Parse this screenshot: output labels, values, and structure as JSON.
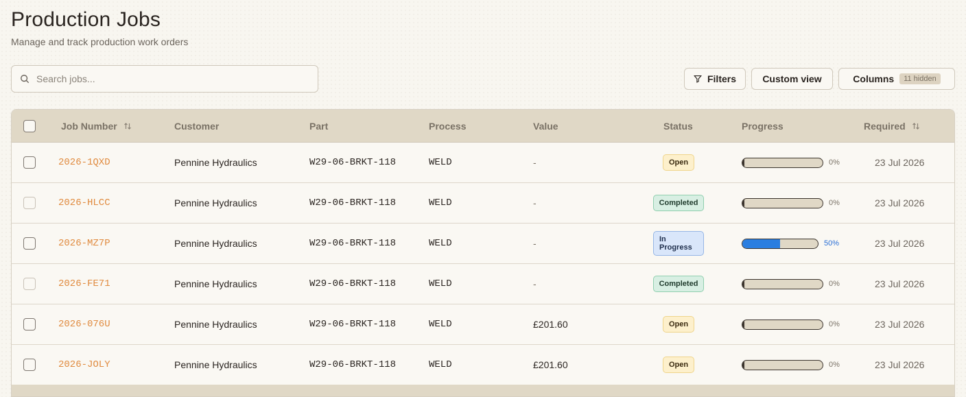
{
  "header": {
    "title": "Production Jobs",
    "subtitle": "Manage and track production work orders"
  },
  "search": {
    "placeholder": "Search jobs...",
    "value": ""
  },
  "toolbar": {
    "filters_label": "Filters",
    "custom_view_label": "Custom view",
    "columns_label": "Columns",
    "columns_hidden": "11 hidden"
  },
  "table": {
    "columns": [
      "Job Number",
      "Customer",
      "Part",
      "Process",
      "Value",
      "Status",
      "Progress",
      "Required"
    ],
    "rows": [
      {
        "job": "2026-1QXD",
        "customer": "Pennine Hydraulics",
        "part": "W29-06-BRKT-118",
        "process": "WELD",
        "value": "-",
        "status": "Open",
        "progress": 0,
        "progress_label": "0%",
        "required": "23 Jul 2026"
      },
      {
        "job": "2026-HLCC",
        "customer": "Pennine Hydraulics",
        "part": "W29-06-BRKT-118",
        "process": "WELD",
        "value": "-",
        "status": "Completed",
        "progress": 0,
        "progress_label": "0%",
        "required": "23 Jul 2026"
      },
      {
        "job": "2026-MZ7P",
        "customer": "Pennine Hydraulics",
        "part": "W29-06-BRKT-118",
        "process": "WELD",
        "value": "-",
        "status": "In Progress",
        "progress": 50,
        "progress_label": "50%",
        "required": "23 Jul 2026"
      },
      {
        "job": "2026-FE71",
        "customer": "Pennine Hydraulics",
        "part": "W29-06-BRKT-118",
        "process": "WELD",
        "value": "-",
        "status": "Completed",
        "progress": 0,
        "progress_label": "0%",
        "required": "23 Jul 2026"
      },
      {
        "job": "2026-076U",
        "customer": "Pennine Hydraulics",
        "part": "W29-06-BRKT-118",
        "process": "WELD",
        "value": "£201.60",
        "status": "Open",
        "progress": 0,
        "progress_label": "0%",
        "required": "23 Jul 2026"
      },
      {
        "job": "2026-JOLY",
        "customer": "Pennine Hydraulics",
        "part": "W29-06-BRKT-118",
        "process": "WELD",
        "value": "£201.60",
        "status": "Open",
        "progress": 0,
        "progress_label": "0%",
        "required": "23 Jul 2026"
      }
    ]
  },
  "colors": {
    "accent_link": "#e08a3e",
    "progress_fill": "#2a7ee0",
    "header_bg": "#e0d8c6"
  },
  "icons": {
    "search": "search-icon",
    "filter": "filter-icon",
    "sort": "sort-icon"
  }
}
